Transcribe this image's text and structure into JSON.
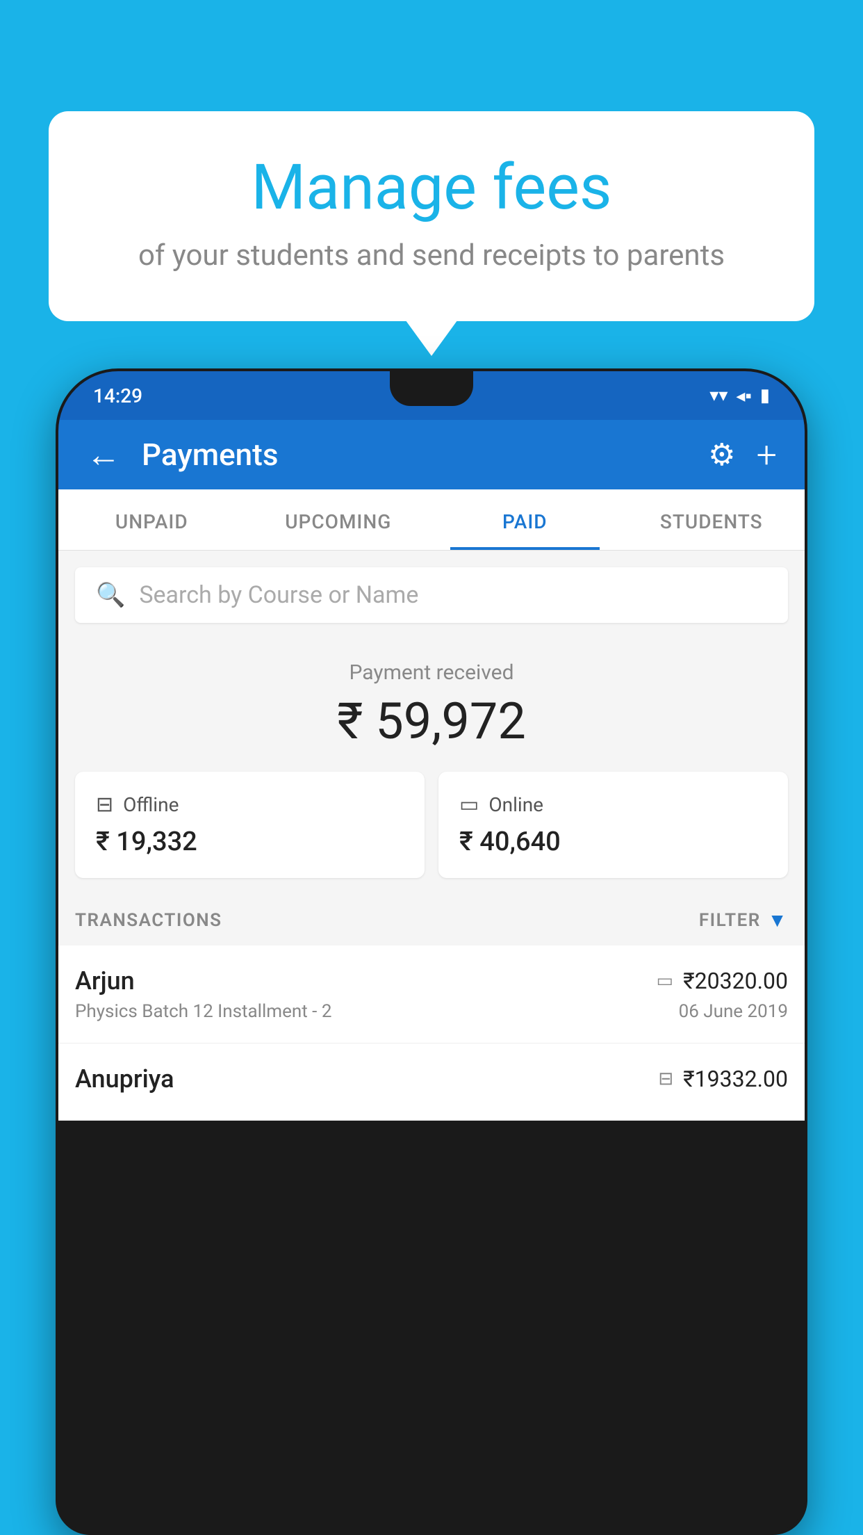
{
  "background_color": "#1ab3e8",
  "bubble": {
    "title": "Manage fees",
    "subtitle": "of your students and send receipts to parents"
  },
  "status_bar": {
    "time": "14:29",
    "wifi": "▼",
    "signal": "▲",
    "battery": "▮"
  },
  "header": {
    "title": "Payments",
    "back_label": "←",
    "gear_label": "⚙",
    "plus_label": "+"
  },
  "tabs": [
    {
      "label": "UNPAID",
      "active": false
    },
    {
      "label": "UPCOMING",
      "active": false
    },
    {
      "label": "PAID",
      "active": true
    },
    {
      "label": "STUDENTS",
      "active": false
    }
  ],
  "search": {
    "placeholder": "Search by Course or Name"
  },
  "payment_received": {
    "label": "Payment received",
    "amount": "₹ 59,972"
  },
  "cards": [
    {
      "label": "Offline",
      "amount": "₹ 19,332",
      "icon": "offline"
    },
    {
      "label": "Online",
      "amount": "₹ 40,640",
      "icon": "online"
    }
  ],
  "transactions_section": {
    "label": "TRANSACTIONS",
    "filter_label": "FILTER"
  },
  "transactions": [
    {
      "name": "Arjun",
      "amount": "₹20320.00",
      "course": "Physics Batch 12 Installment - 2",
      "date": "06 June 2019",
      "payment_type": "card"
    },
    {
      "name": "Anupriya",
      "amount": "₹19332.00",
      "course": "",
      "date": "",
      "payment_type": "offline"
    }
  ]
}
